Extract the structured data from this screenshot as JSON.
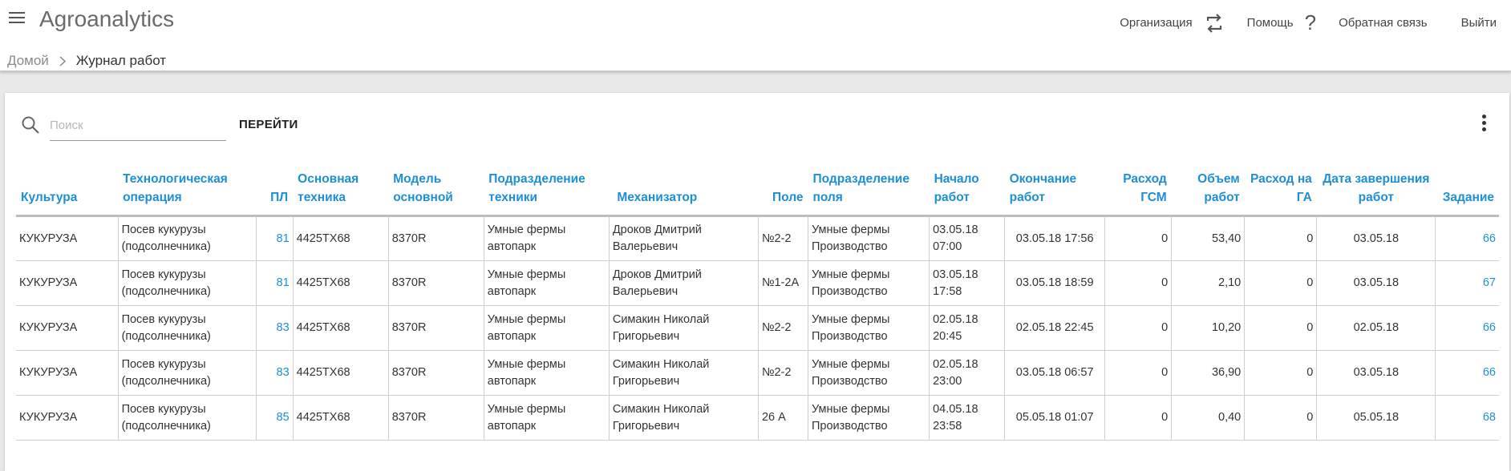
{
  "app": {
    "title": "Agroanalytics"
  },
  "header": {
    "organization_label": "Организация",
    "help_label": "Помощь",
    "feedback_label": "Обратная связь",
    "logout_label": "Выйти"
  },
  "breadcrumb": {
    "home": "Домой",
    "current": "Журнал работ"
  },
  "search": {
    "placeholder": "Поиск",
    "value": "",
    "go_label": "ПЕРЕЙТИ"
  },
  "colors": {
    "accent": "#1e8fd6",
    "border": "#cfcfcf"
  },
  "table": {
    "columns": [
      "Культура",
      "Технологическая операция",
      "ПЛ",
      "Основная техника",
      "Модель основной",
      "Подразделение техники",
      "Механизатор",
      "Поле",
      "Подразделение поля",
      "Начало работ",
      "Окончание работ",
      "Расход ГСМ",
      "Объем работ",
      "Расход на ГА",
      "Дата завершения работ",
      "Задание"
    ],
    "rows": [
      [
        "КУКУРУЗА",
        "Посев кукурузы (подсолнечника)",
        "81",
        "4425ТХ68",
        "8370R",
        "Умные фермы автопарк",
        "Дроков Дмитрий Валерьевич",
        "№2-2",
        "Умные фермы Производство",
        "03.05.18 07:00",
        "03.05.18 17:56",
        "0",
        "53,40",
        "0",
        "03.05.18",
        "66"
      ],
      [
        "КУКУРУЗА",
        "Посев кукурузы (подсолнечника)",
        "81",
        "4425ТХ68",
        "8370R",
        "Умные фермы автопарк",
        "Дроков Дмитрий Валерьевич",
        "№1-2А",
        "Умные фермы Производство",
        "03.05.18 17:58",
        "03.05.18 18:59",
        "0",
        "2,10",
        "0",
        "03.05.18",
        "67"
      ],
      [
        "КУКУРУЗА",
        "Посев кукурузы (подсолнечника)",
        "83",
        "4425ТХ68",
        "8370R",
        "Умные фермы автопарк",
        "Симакин Николай Григорьевич",
        "№2-2",
        "Умные фермы Производство",
        "02.05.18 20:45",
        "02.05.18 22:45",
        "0",
        "10,20",
        "0",
        "02.05.18",
        "66"
      ],
      [
        "КУКУРУЗА",
        "Посев кукурузы (подсолнечника)",
        "83",
        "4425ТХ68",
        "8370R",
        "Умные фермы автопарк",
        "Симакин Николай Григорьевич",
        "№2-2",
        "Умные фермы Производство",
        "02.05.18 23:00",
        "03.05.18 06:57",
        "0",
        "36,90",
        "0",
        "03.05.18",
        "66"
      ],
      [
        "КУКУРУЗА",
        "Посев кукурузы (подсолнечника)",
        "85",
        "4425ТХ68",
        "8370R",
        "Умные фермы автопарк",
        "Симакин Николай Григорьевич",
        "26 А",
        "Умные фермы Производство",
        "04.05.18 23:58",
        "05.05.18 01:07",
        "0",
        "0,40",
        "0",
        "05.05.18",
        "68"
      ]
    ]
  }
}
